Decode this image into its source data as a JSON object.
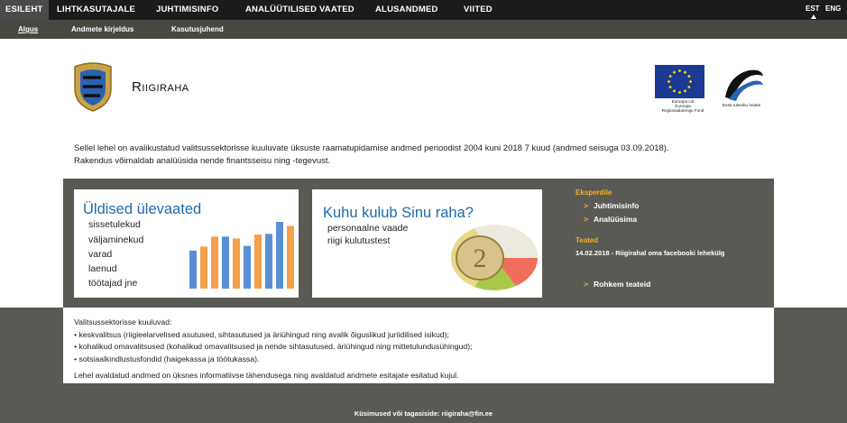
{
  "topnav": {
    "items": [
      "ESILEHT",
      "LIHTKASUTAJALE",
      "JUHTIMISINFO",
      "ANALÜÜTILISED VAATED",
      "ALUSANDMED",
      "VIITED"
    ],
    "lang_est": "EST",
    "lang_eng": "ENG"
  },
  "subnav": {
    "items": [
      "Algus",
      "Andmete kirjeldus",
      "Kasutusjuhend"
    ]
  },
  "header": {
    "title": "Riigiraha",
    "eu_logo_text": [
      "Euroopa Liit",
      "Euroopa",
      "Regionaalarengu Fond"
    ],
    "ee_logo_text": "Eesti tuleviku heaks"
  },
  "intro": {
    "line1": "Sellel lehel on avalikustatud valitsussektorisse kuuluvate üksuste raamatupidamise andmed perioodist 2004 kuni 2018 7 kuud (andmed seisuga 03.09.2018).",
    "line2": "Rakendus võimaldab analüüsida nende finantsseisu ning -tegevust."
  },
  "panel1": {
    "title": "Üldised ülevaated",
    "lines": [
      "sissetulekud",
      "väljaminekud",
      "varad",
      "laenud",
      "töötajad jne"
    ],
    "bars": [
      {
        "color": "#5b8fd4",
        "value": 0.57
      },
      {
        "color": "#f5a04a",
        "value": 0.63
      },
      {
        "color": "#f5a04a",
        "value": 0.78
      },
      {
        "color": "#5b8fd4",
        "value": 0.78
      },
      {
        "color": "#f5a04a",
        "value": 0.75
      },
      {
        "color": "#5b8fd4",
        "value": 0.64
      },
      {
        "color": "#f5a04a",
        "value": 0.81
      },
      {
        "color": "#5b8fd4",
        "value": 0.82
      },
      {
        "color": "#5b8fd4",
        "value": 1.0
      },
      {
        "color": "#f5a04a",
        "value": 0.94
      }
    ]
  },
  "panel2": {
    "title": "Kuhu kulub Sinu raha?",
    "lines": [
      "personaalne vaade",
      "riigi kulutustest"
    ]
  },
  "side": {
    "experts_heading": "Eksperdile",
    "experts_links": [
      "Juhtimisinfo",
      "Analüüsima"
    ],
    "news_heading": "Teated",
    "news_item": "14.02.2018 - Riigirahal oma facebooki lehekülg",
    "more_news": "Rohkem teateid",
    "arrow": ">"
  },
  "info": {
    "heading": "Valitsussektorisse kuuluvad:",
    "bullets": [
      "keskvalitsus (riigieelarvelised asutused, sihtasutused ja äriühingud ning avalik õiguslikud juriidilised isikud);",
      "kohalikud omavalitsused (kohalikud omavalitsused ja nende sihtasutused, äriühingud ning mittetulundusühingud);",
      "sotsiaalkindlustusfondid (haigekassa ja töötukassa)."
    ],
    "disclaimer": "Lehel avaldatud andmed on üksnes informatiivse tähendusega ning avaldatud andmete esitajate esitatud kujul."
  },
  "footer": {
    "text": "Küsimused või tagasiside: riigiraha@fin.ee"
  }
}
